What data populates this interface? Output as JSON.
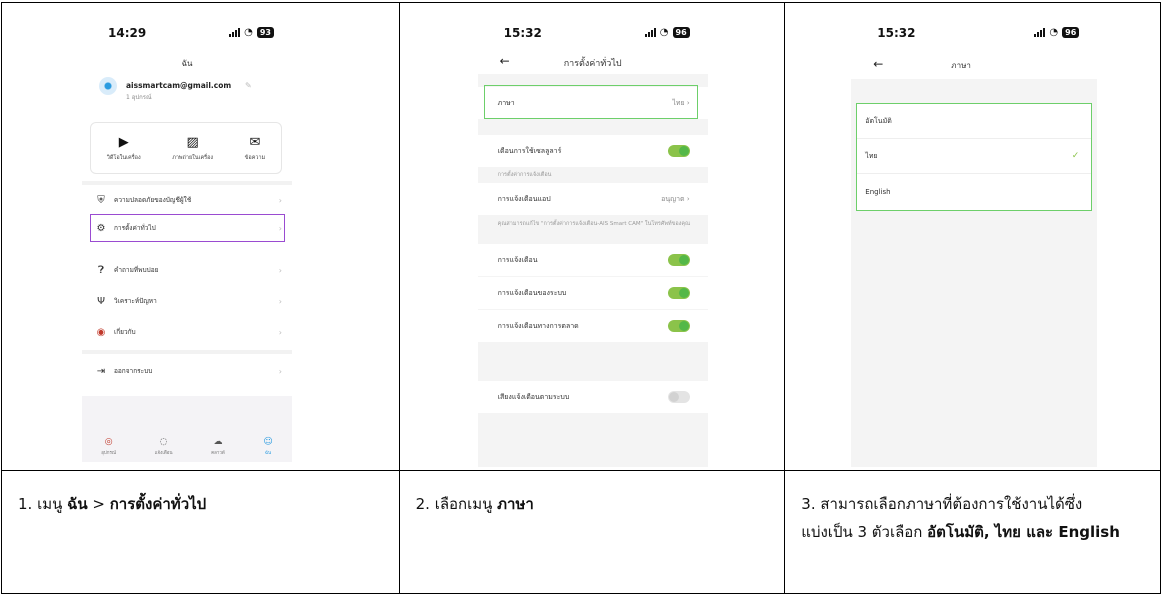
{
  "screen1": {
    "time": "14:29",
    "battery": "93",
    "title": "ฉัน",
    "email": "aissmartcam@gmail.com",
    "device_count": "1 อุปกรณ์",
    "quick_actions": [
      {
        "icon": "play-circle-icon",
        "label": "วิดีโอในเครื่อง"
      },
      {
        "icon": "image-icon",
        "label": "ภาพถ่ายในเครื่อง"
      },
      {
        "icon": "mail-icon",
        "label": "ข้อความ"
      }
    ],
    "menu": [
      {
        "icon": "shield-icon",
        "label": "ความปลอดภัยของบัญชีผู้ใช้"
      },
      {
        "icon": "gear-icon",
        "label": "การตั้งค่าทั่วไป"
      },
      {
        "icon": "help-icon",
        "label": "คำถามที่พบบ่อย"
      },
      {
        "icon": "diagnose-icon",
        "label": "วิเคราะห์ปัญหา"
      },
      {
        "icon": "about-icon",
        "label": "เกี่ยวกับ"
      },
      {
        "icon": "logout-icon",
        "label": "ออกจากระบบ"
      }
    ],
    "tabs": [
      {
        "icon": "device-icon",
        "label": "อุปกรณ์"
      },
      {
        "icon": "message-icon",
        "label": "แจ้งเตือน"
      },
      {
        "icon": "cloud-icon",
        "label": "คลาวด์"
      },
      {
        "icon": "user-icon",
        "label": "ฉัน"
      }
    ]
  },
  "screen2": {
    "time": "15:32",
    "battery": "96",
    "nav_title": "การตั้งค่าทั่วไป",
    "language_label": "ภาษา",
    "language_value": "ไทย",
    "cellular_warning_label": "เตือนการใช้เซลลูลาร์",
    "notification_section": "การตั้งค่าการแจ้งเตือน",
    "app_notification_label": "การแจ้งเตือนแอป",
    "app_notification_value": "อนุญาต",
    "notification_hint": "คุณสามารถแก้ไข \"การตั้งค่าการแจ้งเตือน-AIS Smart CAM\" ในโทรศัพท์ของคุณ",
    "notification_label": "การแจ้งเตือน",
    "system_notification_label": "การแจ้งเตือนของระบบ",
    "marketing_notification_label": "การแจ้งเตือนทางการตลาด",
    "system_sound_label": "เสียงแจ้งเตือนตามระบบ"
  },
  "screen3": {
    "time": "15:32",
    "battery": "96",
    "nav_title": "ภาษา",
    "languages": [
      "อัตโนมัติ",
      "ไทย",
      "English"
    ],
    "selected": "ไทย"
  },
  "captions": {
    "c1_pre": "1. เมนู ",
    "c1_b1": "ฉัน",
    "c1_mid": " > ",
    "c1_b2": "การตั้งค่าทั่วไป",
    "c2_pre": "2. เลือกเมนู ",
    "c2_b": "ภาษา",
    "c3_line1": "3. สามารถเลือกภาษาที่ต้องการใช้งานได้ซึ่ง",
    "c3_line2_pre": "แบ่งเป็น 3 ตัวเลือก ",
    "c3_b": "อัตโนมัติ, ไทย และ English"
  },
  "colors": {
    "highlight_purple": "#9a4bd1",
    "highlight_green": "#6dcf6a",
    "toggle_green": "#54b848"
  }
}
